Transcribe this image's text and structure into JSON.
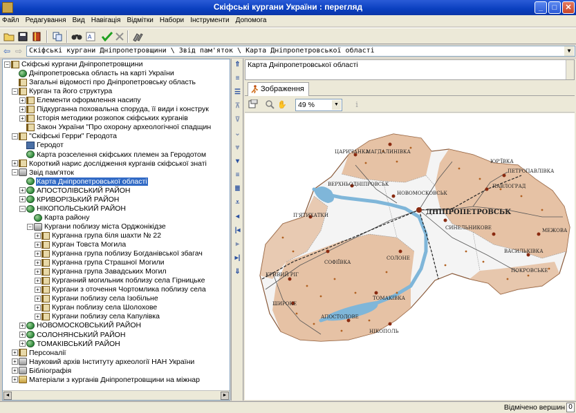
{
  "window": {
    "title": "Скіфські кургани України : перегляд"
  },
  "menu": [
    "Файл",
    "Редагування",
    "Вид",
    "Навігація",
    "Відмітки",
    "Набори",
    "Інструменти",
    "Допомога"
  ],
  "path": {
    "text": "Скіфські кургани Дніпропетровщини \\ Звід пам'яток \\ Карта Дніпропетровської області"
  },
  "tree": [
    {
      "label": "Скіфські кургани Дніпропетровщини",
      "indent": 0,
      "exp": "−",
      "icon": "book"
    },
    {
      "label": "Дніпропетровська область на карті України",
      "indent": 1,
      "exp": "",
      "icon": "globe"
    },
    {
      "label": "Загальні відомості про Дніпропетровську область",
      "indent": 1,
      "exp": "",
      "icon": "book"
    },
    {
      "label": "Курган та його структура",
      "indent": 1,
      "exp": "−",
      "icon": "book"
    },
    {
      "label": "Елементи оформлення насипу",
      "indent": 2,
      "exp": "+",
      "icon": "book"
    },
    {
      "label": "Підкурганна поховальна споруда, її види і конструк",
      "indent": 2,
      "exp": "+",
      "icon": "book"
    },
    {
      "label": "Історія методики розкопок скіфських курганів",
      "indent": 2,
      "exp": "+",
      "icon": "book"
    },
    {
      "label": "Закон України \"Про охорону археологічної спадщин",
      "indent": 2,
      "exp": "",
      "icon": "book"
    },
    {
      "label": "\"Скіфські Герри\" Геродота",
      "indent": 1,
      "exp": "−",
      "icon": "book"
    },
    {
      "label": "Геродот",
      "indent": 2,
      "exp": "",
      "icon": "photo"
    },
    {
      "label": "Карта розселення скіфських племен за Геродотом",
      "indent": 2,
      "exp": "",
      "icon": "globe"
    },
    {
      "label": "Короткий нарис дослідження курганів скіфської знаті",
      "indent": 1,
      "exp": "+",
      "icon": "book"
    },
    {
      "label": "Звід пам'яток",
      "indent": 1,
      "exp": "−",
      "icon": "scroll"
    },
    {
      "label": "Карта Дніпропетровської області",
      "indent": 2,
      "exp": "",
      "icon": "globe",
      "selected": true
    },
    {
      "label": "АПОСТОЛІВСЬКИЙ РАЙОН",
      "indent": 2,
      "exp": "+",
      "icon": "globe"
    },
    {
      "label": "КРИВОРІЗЬКИЙ РАЙОН",
      "indent": 2,
      "exp": "+",
      "icon": "globe"
    },
    {
      "label": "НІКОПОЛЬСЬКИЙ РАЙОН",
      "indent": 2,
      "exp": "−",
      "icon": "globe"
    },
    {
      "label": "Карта району",
      "indent": 3,
      "exp": "",
      "icon": "globe"
    },
    {
      "label": "Кургани поблизу міста Орджонікідзе",
      "indent": 3,
      "exp": "−",
      "icon": "scroll"
    },
    {
      "label": "Курганна група біля шахти № 22",
      "indent": 4,
      "exp": "+",
      "icon": "book"
    },
    {
      "label": "Курган Товста Могила",
      "indent": 4,
      "exp": "+",
      "icon": "book"
    },
    {
      "label": "Курганна група поблизу Богданівської збагач",
      "indent": 4,
      "exp": "+",
      "icon": "book"
    },
    {
      "label": "Курганна група Страшної Могили",
      "indent": 4,
      "exp": "+",
      "icon": "book"
    },
    {
      "label": "Курганна група Завадських Могил",
      "indent": 4,
      "exp": "+",
      "icon": "book"
    },
    {
      "label": "Курганний могильник поблизу села Гірницьке",
      "indent": 4,
      "exp": "+",
      "icon": "book"
    },
    {
      "label": "Кургани з оточення Чортомлика поблизу села",
      "indent": 4,
      "exp": "+",
      "icon": "book"
    },
    {
      "label": "Кургани поблизу села Ізобільне",
      "indent": 4,
      "exp": "+",
      "icon": "book"
    },
    {
      "label": "Курган поблизу села Шолохове",
      "indent": 4,
      "exp": "+",
      "icon": "book"
    },
    {
      "label": "Кургани поблизу села Капулівка",
      "indent": 4,
      "exp": "+",
      "icon": "book"
    },
    {
      "label": "НОВОМОСКОВСЬКИЙ РАЙОН",
      "indent": 2,
      "exp": "+",
      "icon": "globe"
    },
    {
      "label": "СОЛОНЯНСЬКИЙ РАЙОН",
      "indent": 2,
      "exp": "+",
      "icon": "globe"
    },
    {
      "label": "ТОМАКІВСЬКИЙ РАЙОН",
      "indent": 2,
      "exp": "+",
      "icon": "globe"
    },
    {
      "label": "Персоналії",
      "indent": 1,
      "exp": "+",
      "icon": "book"
    },
    {
      "label": "Науковий архів Інституту археології НАН України",
      "indent": 1,
      "exp": "+",
      "icon": "scroll"
    },
    {
      "label": "Бібліографія",
      "indent": 1,
      "exp": "+",
      "icon": "scroll"
    },
    {
      "label": "Матеріали з курганів Дніпропетровщини на міжнар",
      "indent": 1,
      "exp": "+",
      "icon": "folder"
    }
  ],
  "document": {
    "title": "Карта Дніпропетровської області",
    "tab_label": "Зображення",
    "zoom": "49 %"
  },
  "map_labels": {
    "city": "ДНІПРОПЕТРОВСЬК",
    "towns": [
      "ПАВЛОГРАД",
      "НОВОМОСКОВСЬК",
      "ЮР'ЇВКА",
      "ПЕТРОПАВЛІВКА",
      "МЕЖОВА",
      "ВАСИЛЬКІВКА",
      "ПОКРОВСЬКЕ",
      "СИНЕЛЬНИКОВЕ",
      "МАГДАЛИНІВКА",
      "ЦАРИЧАНКА",
      "ВЕРХНЬОДНІПРОВСЬК",
      "П'ЯТИХАТКИ",
      "СОФІЇВКА",
      "КРИВИЙ РІГ",
      "ШИРОКЕ",
      "АПОСТОЛОВЕ",
      "НІКОПОЛЬ",
      "ТОМАКІВКА",
      "СОЛОНЕ"
    ]
  },
  "status": {
    "label": "Відмічено вершин",
    "count": "0"
  },
  "colors": {
    "map_region_fill": "#e3b896",
    "map_light_fill": "#f4f4f4",
    "map_water": "#7fb6d9",
    "selection": "#316ac5"
  }
}
